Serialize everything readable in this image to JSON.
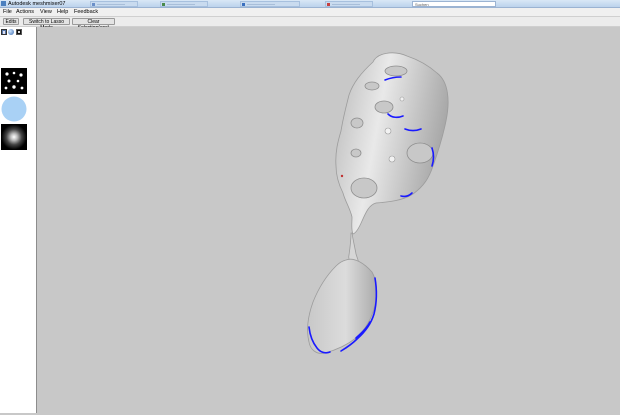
{
  "window": {
    "title": "Autodesk meshmixer07"
  },
  "taskbar": {
    "search_placeholder": "Suchen"
  },
  "menu": [
    "File",
    "Actions",
    "View",
    "Help",
    "Feedback"
  ],
  "toolbar": {
    "edits_label": "Edits",
    "lasso_label": "Switch to Lasso Mode",
    "clear_label": "Clear Selection(esc)"
  },
  "left_panel": {
    "tabs": [
      "brush-tool-icon",
      "sphere-icon",
      "material-icon"
    ],
    "brushes": [
      "dots-brush",
      "flat-circle-brush",
      "soft-glow-brush"
    ]
  },
  "colors": {
    "viewport": "#c8c8c8",
    "mesh": "#dadada",
    "selection_boundary": "#1a1aff",
    "sphere_brush": "#a9d1f5"
  }
}
